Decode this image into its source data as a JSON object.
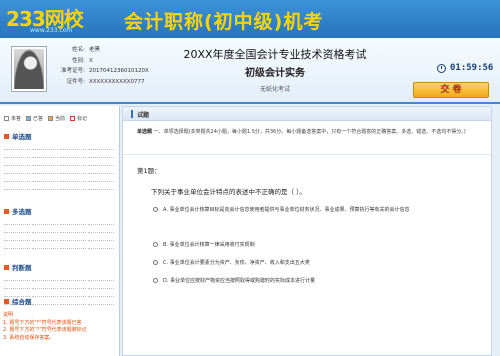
{
  "header": {
    "logo": "233网校",
    "logo_sub": "www.233.com",
    "title": "会计职称(初中级)机考"
  },
  "candidate": {
    "name_label": "姓名:",
    "name_value": "老黑",
    "gender_label": "性别:",
    "gender_value": "X",
    "ticket_label": "准考证号:",
    "ticket_value": "2017041236010120X",
    "id_label": "证件号:",
    "id_value": "XXXXXXXXXXX0777"
  },
  "exam": {
    "title": "20XX年度全国会计专业技术资格考试",
    "subject": "初级会计实务",
    "mode": "无纸化考试"
  },
  "timer": {
    "value": "01:59:56",
    "icon": "clock-icon"
  },
  "submit_label": "交 卷",
  "legend": {
    "unanswered": "未答",
    "answered": "已答",
    "current": "当前",
    "marked": "标记"
  },
  "sidebar_sections": [
    {
      "label": "单选题"
    },
    {
      "label": "多选题"
    },
    {
      "label": "判断题"
    },
    {
      "label": "综合题"
    }
  ],
  "hint": {
    "title": "说明",
    "line1": "1. 题号下方的\"*\"符号代表该题已答",
    "line2": "2. 题号下方的\"?\"符号代表该题被标记",
    "line3": "3. 系统自动保存答案。"
  },
  "section": {
    "header": "试题",
    "instr_title": "单选题",
    "instr_text": "一、单项选择题(本类题共24小题，每小题1.5分，共36分。每小题备选答案中，只有一个符合题意的正确答案。多选、错选、不选均不得分。)"
  },
  "question": {
    "number": "第1题：",
    "text": "下列关于事业单位会计特点的表述中不正确的是（    ）。",
    "options": [
      {
        "letter": "A.",
        "text": "事业单位会计核算目标是向会计信息使用者提供与事业单位财务状况、事业成果、预算执行等有关的会计信息"
      },
      {
        "letter": "B.",
        "text": "事业单位会计核算一律采用收付实现制"
      },
      {
        "letter": "C.",
        "text": "事业单位会计要素分为资产、负债、净资产、收入和支出五大类"
      },
      {
        "letter": "D.",
        "text": "事业单位应按财产物资应当按照取得或购建时的实际成本进行计量"
      }
    ]
  }
}
